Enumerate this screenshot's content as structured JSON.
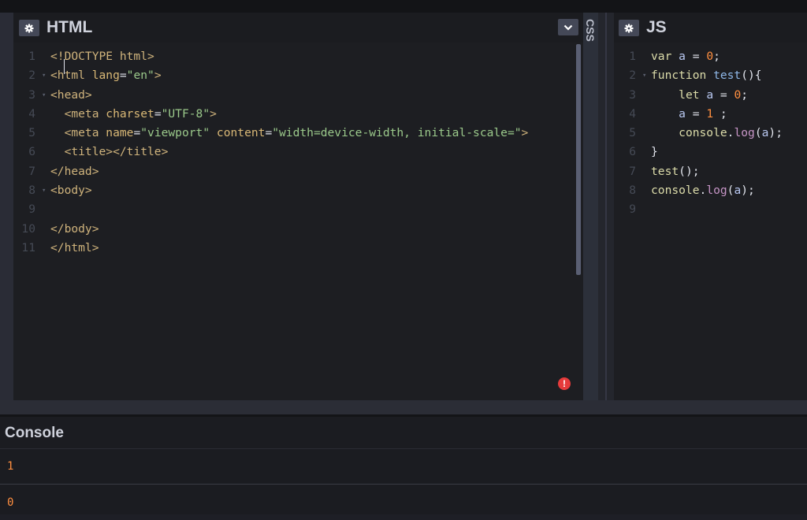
{
  "html_panel": {
    "title": "HTML",
    "settings_icon": "gear-icon",
    "collapse_icon": "chevron-down-icon",
    "error_icon": "exclamation-icon",
    "error_color": "#e63b3b",
    "lines": [
      {
        "n": "1",
        "fold": false,
        "tokens": [
          [
            "tag",
            "<!DOCTYPE html>"
          ]
        ]
      },
      {
        "n": "2",
        "fold": true,
        "tokens": [
          [
            "tag",
            "<html "
          ],
          [
            "attr",
            "lang"
          ],
          [
            "plain",
            "="
          ],
          [
            "str",
            "\"en\""
          ],
          [
            "tag",
            ">"
          ]
        ]
      },
      {
        "n": "3",
        "fold": true,
        "tokens": [
          [
            "tag",
            "<head>"
          ]
        ]
      },
      {
        "n": "4",
        "fold": false,
        "tokens": [
          [
            "plain",
            "  "
          ],
          [
            "tag",
            "<meta "
          ],
          [
            "attr",
            "charset"
          ],
          [
            "plain",
            "="
          ],
          [
            "str",
            "\"UTF-8\""
          ],
          [
            "tag",
            ">"
          ]
        ]
      },
      {
        "n": "5",
        "fold": false,
        "tokens": [
          [
            "plain",
            "  "
          ],
          [
            "tag",
            "<meta "
          ],
          [
            "attr",
            "name"
          ],
          [
            "plain",
            "="
          ],
          [
            "str",
            "\"viewport\""
          ],
          [
            "plain",
            " "
          ],
          [
            "attr",
            "content"
          ],
          [
            "plain",
            "="
          ],
          [
            "str",
            "\"width=device-width, initial-scale=\""
          ],
          [
            "tag",
            ">"
          ]
        ]
      },
      {
        "n": "6",
        "fold": false,
        "tokens": [
          [
            "plain",
            "  "
          ],
          [
            "tag",
            "<title></title>"
          ]
        ]
      },
      {
        "n": "7",
        "fold": false,
        "tokens": [
          [
            "tag",
            "</head>"
          ]
        ]
      },
      {
        "n": "8",
        "fold": true,
        "tokens": [
          [
            "tag",
            "<body>"
          ]
        ]
      },
      {
        "n": "9",
        "fold": false,
        "tokens": []
      },
      {
        "n": "10",
        "fold": false,
        "tokens": [
          [
            "tag",
            "</body>"
          ]
        ]
      },
      {
        "n": "11",
        "fold": false,
        "tokens": [
          [
            "tag",
            "</html>"
          ]
        ]
      }
    ]
  },
  "css_panel": {
    "title": "CSS"
  },
  "js_panel": {
    "title": "JS",
    "settings_icon": "gear-icon",
    "lines": [
      {
        "n": "1",
        "fold": false,
        "tokens": [
          [
            "kw",
            "var "
          ],
          [
            "varc",
            "a"
          ],
          [
            "plain",
            " = "
          ],
          [
            "num",
            "0"
          ],
          [
            "plain",
            ";"
          ]
        ]
      },
      {
        "n": "2",
        "fold": true,
        "tokens": [
          [
            "kw",
            "function "
          ],
          [
            "fn",
            "test"
          ],
          [
            "plain",
            "(){"
          ]
        ]
      },
      {
        "n": "3",
        "fold": false,
        "tokens": [
          [
            "plain",
            "    "
          ],
          [
            "kw",
            "let "
          ],
          [
            "varc",
            "a"
          ],
          [
            "plain",
            " = "
          ],
          [
            "num",
            "0"
          ],
          [
            "plain",
            ";"
          ]
        ]
      },
      {
        "n": "4",
        "fold": false,
        "tokens": [
          [
            "plain",
            "    "
          ],
          [
            "varc",
            "a"
          ],
          [
            "plain",
            " = "
          ],
          [
            "num",
            "1"
          ],
          [
            "plain",
            " ;"
          ]
        ]
      },
      {
        "n": "5",
        "fold": false,
        "tokens": [
          [
            "plain",
            "    "
          ],
          [
            "kw",
            "console"
          ],
          [
            "plain",
            "."
          ],
          [
            "prop",
            "log"
          ],
          [
            "plain",
            "("
          ],
          [
            "varc",
            "a"
          ],
          [
            "plain",
            ");"
          ]
        ]
      },
      {
        "n": "6",
        "fold": false,
        "tokens": [
          [
            "plain",
            "}"
          ]
        ]
      },
      {
        "n": "7",
        "fold": false,
        "tokens": [
          [
            "kw",
            "test"
          ],
          [
            "plain",
            "();"
          ]
        ]
      },
      {
        "n": "8",
        "fold": false,
        "tokens": [
          [
            "kw",
            "console"
          ],
          [
            "plain",
            "."
          ],
          [
            "prop",
            "log"
          ],
          [
            "plain",
            "("
          ],
          [
            "varc",
            "a"
          ],
          [
            "plain",
            ");"
          ]
        ]
      },
      {
        "n": "9",
        "fold": false,
        "tokens": []
      }
    ]
  },
  "console": {
    "title": "Console",
    "outputs": [
      "1",
      "0"
    ],
    "output_color": "#ff8f40"
  }
}
